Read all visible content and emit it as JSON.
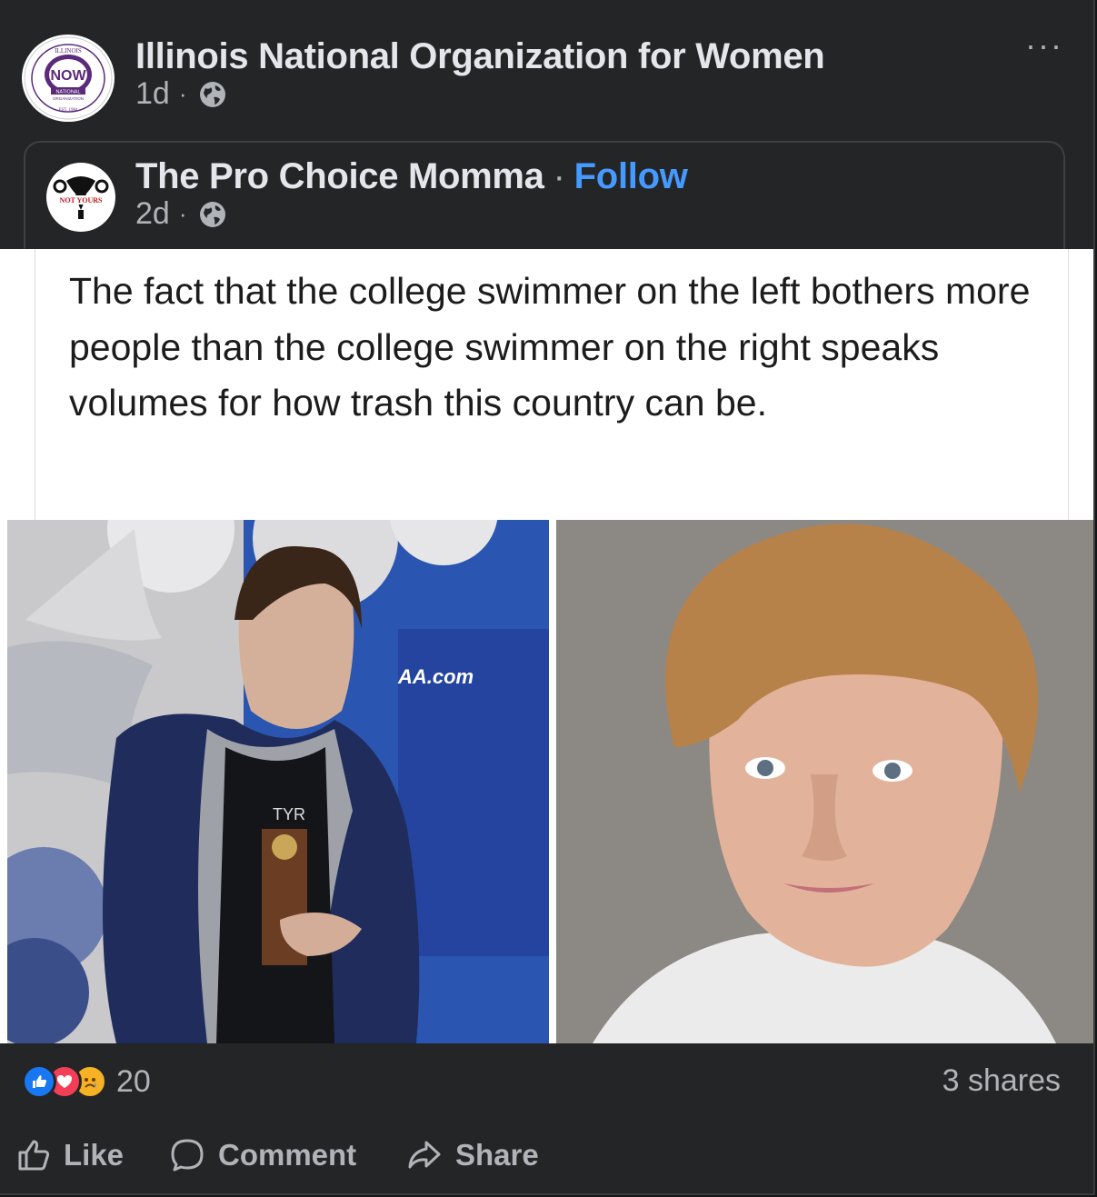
{
  "post": {
    "author": "Illinois National Organization for Women",
    "time": "1d",
    "separator": "·",
    "more_label": "···",
    "avatar": {
      "ring_top": "ILLINOIS",
      "center": "NOW",
      "banner": "NATIONAL",
      "sub": "ORGANIZATION",
      "est": "EST. 1984"
    }
  },
  "shared": {
    "author": "The Pro Choice Momma",
    "follow": "Follow",
    "time": "2d",
    "avatar_text": "NOT YOURS"
  },
  "meme": {
    "caption": "The fact that the college swimmer on the left bothers more people than the college swimmer on the right speaks volumes for how trash this country can be.",
    "left_photo_text": [
      "AA.com",
      "TYR"
    ]
  },
  "stats": {
    "reactions": [
      "like",
      "love",
      "sad"
    ],
    "reaction_count": "20",
    "shares": "3 shares"
  },
  "actions": {
    "like": "Like",
    "comment": "Comment",
    "share": "Share"
  },
  "colors": {
    "background": "#242526",
    "text": "#e4e6eb",
    "muted": "#b0b3b8",
    "link": "#4599ff"
  }
}
